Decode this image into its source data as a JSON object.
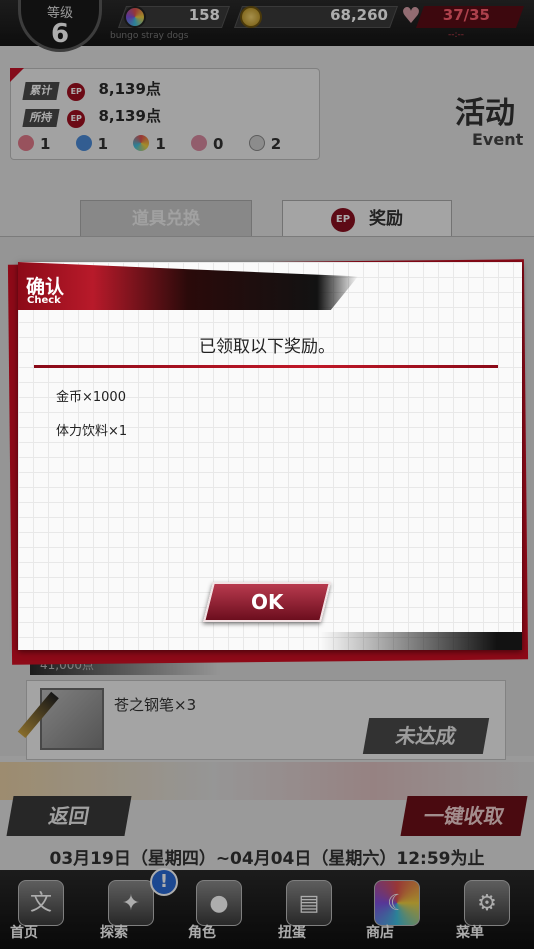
{
  "status_bar": {
    "level_label": "等级",
    "level_value": "6",
    "gems": "158",
    "coins": "68,260",
    "stamina": "37/35",
    "subtitle": "bungo stray dogs",
    "timer": "--:--"
  },
  "event_info": {
    "total_label": "累计",
    "total_value": "8,139点",
    "owned_label": "所持",
    "owned_value": "8,139点",
    "ep_tag": "EP",
    "items": [
      {
        "icon": "pink-gem",
        "count": "1"
      },
      {
        "icon": "blue-gem",
        "count": "1"
      },
      {
        "icon": "rainbow-gem",
        "count": "1"
      },
      {
        "icon": "flower",
        "count": "0"
      },
      {
        "icon": "paw",
        "count": "2"
      }
    ]
  },
  "event_title": {
    "cn": "活动",
    "en": "Event"
  },
  "tabs": [
    {
      "label": "道具兑换",
      "active": false
    },
    {
      "label": "奖励",
      "active": true,
      "icon": "EP"
    }
  ],
  "reward_list": {
    "points_partial": "41,000点",
    "item_name": "苍之钢笔×3",
    "status_button": "未达成"
  },
  "buttons": {
    "back": "返回",
    "claim_all": "一键收取"
  },
  "period": "03月19日（星期四）~04月04日（星期六）12:59为止",
  "bottom_nav": [
    {
      "label": "首页",
      "icon": "home-icon"
    },
    {
      "label": "探索",
      "icon": "explore-icon"
    },
    {
      "label": "角色",
      "icon": "character-icon"
    },
    {
      "label": "扭蛋",
      "icon": "gacha-icon"
    },
    {
      "label": "商店",
      "icon": "shop-icon"
    },
    {
      "label": "菜单",
      "icon": "gear-icon"
    }
  ],
  "nav_badge": "!",
  "modal": {
    "title": "确认",
    "title_en": "Check",
    "message": "已领取以下奖励。",
    "rewards": [
      "金币×1000",
      "体力饮料×1"
    ],
    "ok_label": "OK"
  },
  "colors": {
    "accent_red": "#8e0a18",
    "ok_button": "#9a2438",
    "stamina": "#d04050"
  }
}
